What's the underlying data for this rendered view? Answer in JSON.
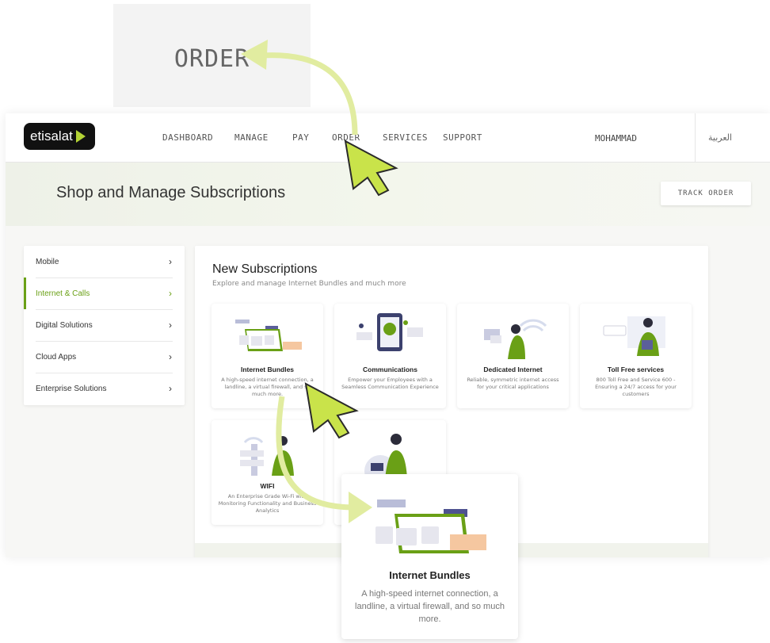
{
  "zoom_label": "ORDER",
  "logo_text": "etisalat",
  "nav": [
    "DASHBOARD",
    "MANAGE",
    "PAY",
    "ORDER",
    "SERVICES",
    "SUPPORT"
  ],
  "user": "MOHAMMAD",
  "language": "العربية",
  "banner": {
    "title": "Shop and Manage Subscriptions",
    "track_order": "TRACK ORDER"
  },
  "sidebar": {
    "items": [
      {
        "label": "Mobile",
        "chevron": "›"
      },
      {
        "label": "Internet & Calls",
        "chevron": "›"
      },
      {
        "label": "Digital Solutions",
        "chevron": "›"
      },
      {
        "label": "Cloud Apps",
        "chevron": "›"
      },
      {
        "label": "Enterprise Solutions",
        "chevron": "›"
      }
    ],
    "active_index": 1
  },
  "panel": {
    "title": "New Subscriptions",
    "subtitle": "Explore and manage Internet Bundles and much more",
    "cards": [
      {
        "title": "Internet Bundles",
        "desc": "A high-speed internet connection, a landline, a virtual firewall, and so much more."
      },
      {
        "title": "Communications",
        "desc": "Empower your Employees with a Seamless Communication Experience"
      },
      {
        "title": "Dedicated Internet",
        "desc": "Reliable, symmetric internet access for your critical applications"
      },
      {
        "title": "Toll Free services",
        "desc": "800 Toll Free and Service 600 - Ensuring a 24/7 access for your customers"
      },
      {
        "title": "WIFI",
        "desc": "An Enterprise Grade Wi-Fi with Monitoring Functionality and Business Analytics"
      },
      {
        "title": "",
        "desc": ""
      }
    ]
  },
  "zoom_card": {
    "title": "Internet Bundles",
    "desc": "A high-speed internet connection, a landline, a virtual firewall, and so much more."
  },
  "colors": {
    "accent": "#6aa016",
    "highlight": "#c9e34a",
    "arrow": "#e1eca0"
  },
  "icons": [
    "chevron-right-icon",
    "cursor-icon",
    "curved-arrow-icon",
    "envelope-icon",
    "shield-icon",
    "wifi-icon"
  ]
}
